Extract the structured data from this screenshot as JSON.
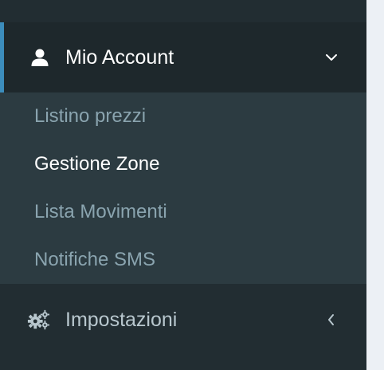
{
  "sidebar": {
    "account": {
      "label": "Mio Account",
      "icon": "user-icon",
      "chevron": "chevron-down-icon",
      "submenu": [
        {
          "label": "Listino prezzi",
          "active": false
        },
        {
          "label": "Gestione Zone",
          "active": true
        },
        {
          "label": "Lista Movimenti",
          "active": false
        },
        {
          "label": "Notifiche SMS",
          "active": false
        }
      ]
    },
    "settings": {
      "label": "Impostazioni",
      "icon": "gears-icon",
      "chevron": "chevron-left-icon"
    }
  },
  "colors": {
    "sidebar_bg": "#222d32",
    "active_item_bg": "#1e282c",
    "submenu_bg": "#2c3b41",
    "accent": "#3c8dbc",
    "content_bg": "#ecf0f5",
    "text_active": "#ffffff",
    "text_muted": "#8aa4af"
  }
}
